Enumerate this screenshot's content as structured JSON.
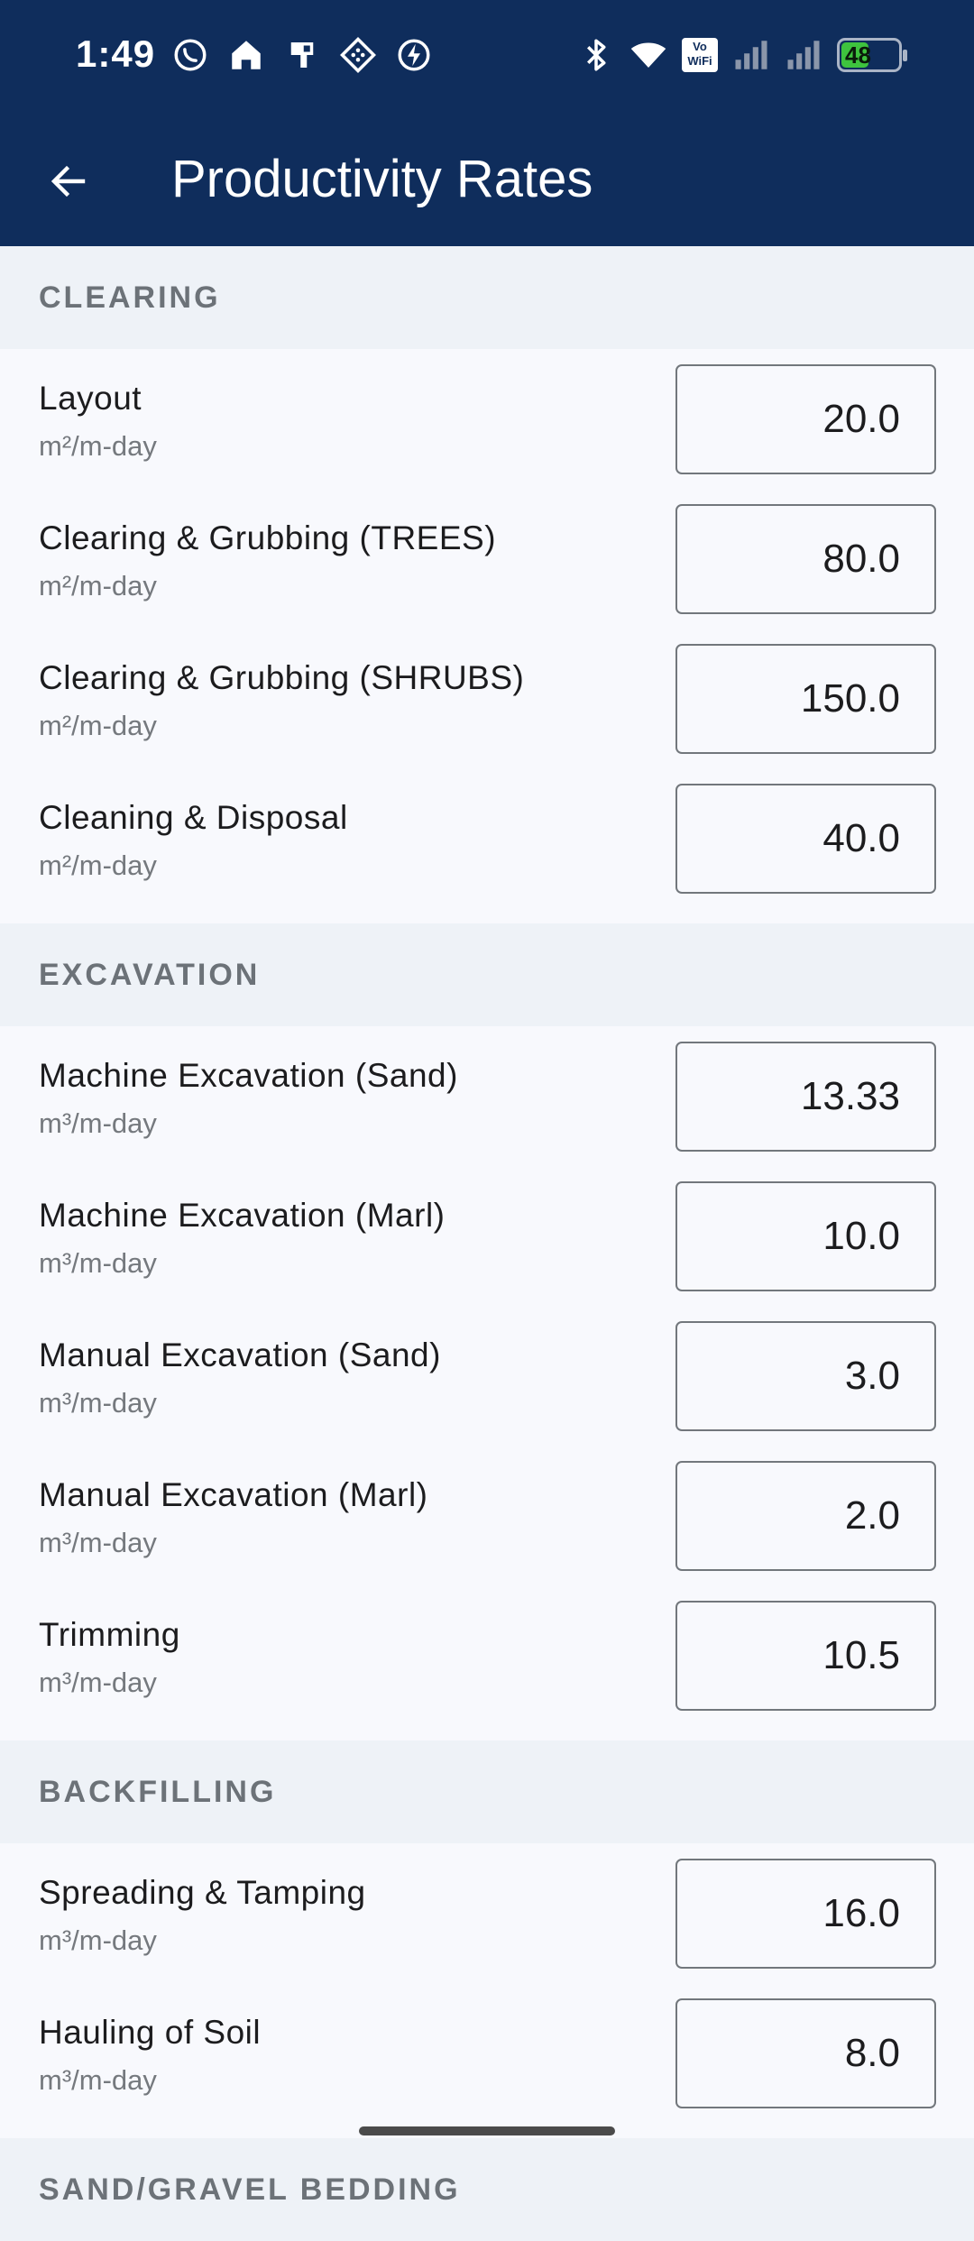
{
  "status": {
    "time": "1:49",
    "battery_percent": "48",
    "battery_level": 0.48,
    "vowifi_line1": "Vo",
    "vowifi_line2": "WiFi",
    "left_icons": [
      "whatsapp-icon",
      "home-icon",
      "sim-icon",
      "diamond-icon",
      "flash-icon"
    ],
    "right_icons": [
      "bluetooth-icon",
      "wifi-icon",
      "vowifi-icon",
      "signal-icon",
      "signal-icon",
      "battery-icon"
    ]
  },
  "appbar": {
    "title": "Productivity Rates",
    "back_icon": "back-arrow-icon"
  },
  "sections": [
    {
      "title": "CLEARING",
      "items": [
        {
          "label": "Layout",
          "unit": "m²/m-day",
          "value": "20.0"
        },
        {
          "label": "Clearing & Grubbing (TREES)",
          "unit": "m²/m-day",
          "value": "80.0"
        },
        {
          "label": "Clearing & Grubbing (SHRUBS)",
          "unit": "m²/m-day",
          "value": "150.0"
        },
        {
          "label": "Cleaning & Disposal",
          "unit": "m²/m-day",
          "value": "40.0"
        }
      ]
    },
    {
      "title": "EXCAVATION",
      "items": [
        {
          "label": "Machine Excavation (Sand)",
          "unit": "m³/m-day",
          "value": "13.33"
        },
        {
          "label": "Machine Excavation (Marl)",
          "unit": "m³/m-day",
          "value": "10.0"
        },
        {
          "label": "Manual Excavation (Sand)",
          "unit": "m³/m-day",
          "value": "3.0"
        },
        {
          "label": "Manual Excavation (Marl)",
          "unit": "m³/m-day",
          "value": "2.0"
        },
        {
          "label": "Trimming",
          "unit": "m³/m-day",
          "value": "10.5"
        }
      ]
    },
    {
      "title": "BACKFILLING",
      "items": [
        {
          "label": "Spreading & Tamping",
          "unit": "m³/m-day",
          "value": "16.0"
        },
        {
          "label": "Hauling of Soil",
          "unit": "m³/m-day",
          "value": "8.0"
        }
      ]
    },
    {
      "title": "SAND/GRAVEL BEDDING",
      "items": []
    }
  ]
}
